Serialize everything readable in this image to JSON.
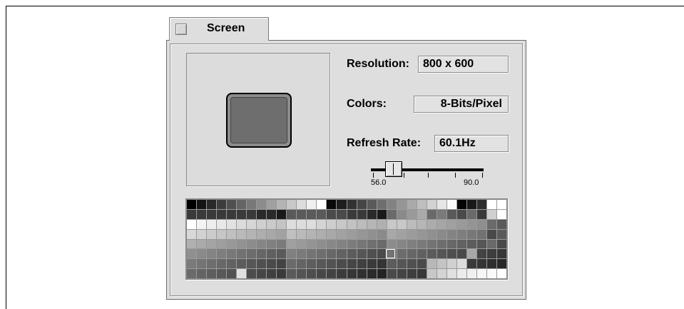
{
  "tab": {
    "title": "Screen"
  },
  "settings": {
    "resolution_label": "Resolution:",
    "resolution_value": "800 x 600",
    "colors_label": "Colors:",
    "colors_value": "8-Bits/Pixel",
    "refresh_label": "Refresh Rate:",
    "refresh_value": "60.1Hz"
  },
  "slider": {
    "min_label": "56.0",
    "max_label": "90.0"
  },
  "palette": {
    "rows": [
      [
        "#000000",
        "#141414",
        "#282828",
        "#3c3c3c",
        "#505050",
        "#646464",
        "#787878",
        "#8c8c8c",
        "#a0a0a0",
        "#b4b4b4",
        "#c8c8c8",
        "#dcdcdc",
        "#f0f0f0",
        "#ffffff",
        "#0a0a0a",
        "#1e1e1e",
        "#323232",
        "#464646",
        "#5a5a5a",
        "#6e6e6e",
        "#828282",
        "#969696",
        "#aaaaaa",
        "#bebebe",
        "#d2d2d2",
        "#e6e6e6",
        "#fafafa",
        "#050505",
        "#191919",
        "#2d2d2d",
        "#ffffff",
        "#ffffff"
      ],
      [
        "#3a3a3a",
        "#3a3a3a",
        "#3a3a3a",
        "#3a3a3a",
        "#3a3a3a",
        "#3a3a3a",
        "#3a3a3a",
        "#2a2a2a",
        "#2a2a2a",
        "#1a1a1a",
        "#5a5a5a",
        "#5a5a5a",
        "#5a5a5a",
        "#5a5a5a",
        "#4a4a4a",
        "#4a4a4a",
        "#3a3a3a",
        "#3a3a3a",
        "#2a2a2a",
        "#1a1a1a",
        "#6a6a6a",
        "#8a8a8a",
        "#9a9a9a",
        "#aaaaaa",
        "#6a6a6a",
        "#7a7a7a",
        "#5a5a5a",
        "#4a4a4a",
        "#6a6a6a",
        "#3a3a3a",
        "#d0d0d0",
        "#ffffff"
      ],
      [
        "#ffffff",
        "#f4f4f4",
        "#eeeeee",
        "#e8e8e8",
        "#e2e2e2",
        "#dcdcdc",
        "#d6d6d6",
        "#d0d0d0",
        "#cacaca",
        "#c4c4c4",
        "#dddddd",
        "#dddddd",
        "#dddddd",
        "#d4d4d4",
        "#cecece",
        "#c8c8c8",
        "#c2c2c2",
        "#bcbcbc",
        "#b6b6b6",
        "#b0b0b0",
        "#c8c8c8",
        "#c8c8c8",
        "#bcbcbc",
        "#b6b6b6",
        "#acacac",
        "#a6a6a6",
        "#a0a0a0",
        "#9a9a9a",
        "#949494",
        "#8e8e8e",
        "#6a6a6a",
        "#5a5a5a"
      ],
      [
        "#d8d8d8",
        "#d2d2d2",
        "#cccccc",
        "#c6c6c6",
        "#c0c0c0",
        "#bababa",
        "#b4b4b4",
        "#aeaeae",
        "#a8a8a8",
        "#a2a2a2",
        "#c0c0c0",
        "#bababa",
        "#b4b4b4",
        "#aeaeae",
        "#a8a8a8",
        "#a2a2a2",
        "#9c9c9c",
        "#969696",
        "#909090",
        "#8a8a8a",
        "#a8a8a8",
        "#a2a2a2",
        "#9c9c9c",
        "#969696",
        "#909090",
        "#8a8a8a",
        "#848484",
        "#7e7e7e",
        "#787878",
        "#727272",
        "#4a4a4a",
        "#5a5a5a"
      ],
      [
        "#b0b0b0",
        "#aaaaaa",
        "#a4a4a4",
        "#9e9e9e",
        "#989898",
        "#929292",
        "#8c8c8c",
        "#868686",
        "#808080",
        "#7a7a7a",
        "#a0a0a0",
        "#9a9a9a",
        "#949494",
        "#8e8e8e",
        "#888888",
        "#828282",
        "#7c7c7c",
        "#767676",
        "#707070",
        "#6a6a6a",
        "#8c8c8c",
        "#868686",
        "#808080",
        "#7a7a7a",
        "#747474",
        "#6e6e6e",
        "#686868",
        "#626262",
        "#5c5c5c",
        "#565656",
        "#6a6a6a",
        "#4a4a4a"
      ],
      [
        "#909090",
        "#8a8a8a",
        "#848484",
        "#7e7e7e",
        "#787878",
        "#727272",
        "#6c6c6c",
        "#666666",
        "#606060",
        "#5a5a5a",
        "#808080",
        "#7a7a7a",
        "#747474",
        "#6e6e6e",
        "#686868",
        "#626262",
        "#5c5c5c",
        "#565656",
        "#505050",
        "#4a4a4a",
        "#737373",
        "#6d6d6d",
        "#676767",
        "#616161",
        "#5b5b5b",
        "#555555",
        "#4f4f4f",
        "#494949",
        "#a8a8a8",
        "#434343",
        "#3d3d3d",
        "#373737"
      ],
      [
        "#7a7a7a",
        "#747474",
        "#6e6e6e",
        "#686868",
        "#626262",
        "#5c5c5c",
        "#565656",
        "#505050",
        "#4a4a4a",
        "#444444",
        "#6a6a6a",
        "#646464",
        "#5e5e5e",
        "#585858",
        "#525252",
        "#4c4c4c",
        "#464646",
        "#404040",
        "#3a3a3a",
        "#343434",
        "#5c5c5c",
        "#565656",
        "#505050",
        "#4a4a4a",
        "#b8b8b8",
        "#c4c4c4",
        "#d0d0d0",
        "#dcdcdc",
        "#3a3a3a",
        "#343434",
        "#2e2e2e",
        "#282828"
      ],
      [
        "#6a6a6a",
        "#646464",
        "#5e5e5e",
        "#585858",
        "#525252",
        "#e0e0e0",
        "#4c4c4c",
        "#464646",
        "#404040",
        "#3a3a3a",
        "#5a5a5a",
        "#545454",
        "#4e4e4e",
        "#484848",
        "#424242",
        "#3c3c3c",
        "#363636",
        "#303030",
        "#2a2a2a",
        "#242424",
        "#4a4a4a",
        "#444444",
        "#3e3e3e",
        "#383838",
        "#c8c8c8",
        "#d4d4d4",
        "#e0e0e0",
        "#ececec",
        "#f0f0f0",
        "#f6f6f6",
        "#fafafa",
        "#ffffff"
      ]
    ]
  }
}
